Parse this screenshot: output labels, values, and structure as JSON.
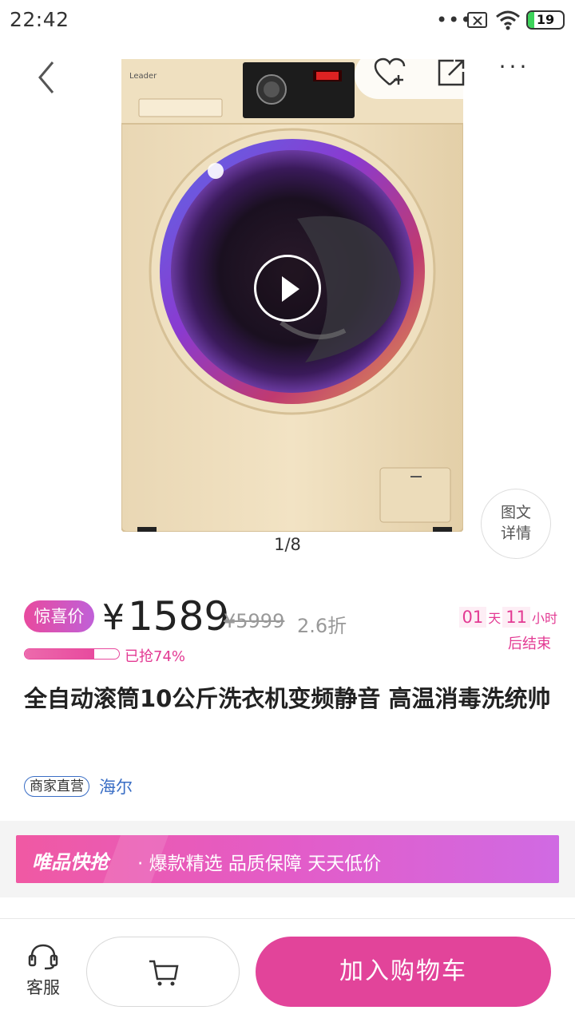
{
  "status_bar": {
    "time": "22:42",
    "battery": "19",
    "battery_level": 0.19
  },
  "hero": {
    "image_index": "1/8",
    "detail_button": [
      "图文",
      "详情"
    ]
  },
  "price": {
    "tag": "惊喜价",
    "currency": "¥",
    "current": "1589",
    "original": "¥5999",
    "discount": "2.6折",
    "sold_progress": 0.74,
    "sold_label": "已抢74%",
    "countdown": {
      "days": "01",
      "day_unit": "天",
      "hours": "11",
      "hour_unit": "小时",
      "end_label": "后结束"
    }
  },
  "product": {
    "title": "全自动滚筒10公斤洗衣机变频静音 高温消毒洗统帅",
    "merchant_tag": "商家直营",
    "brand": "海尔"
  },
  "promo_banner": {
    "brand": "唯品快抢",
    "text": "· 爆款精选  品质保障  天天低价"
  },
  "bottom_bar": {
    "service_label": "客服",
    "add_to_cart": "加入购物车"
  },
  "colors": {
    "accent": "#e2449a",
    "promo_gradient_start": "#f059a3",
    "promo_gradient_end": "#d06ae3",
    "link_blue": "#3a6ec5"
  },
  "icons": [
    "back-arrow-icon",
    "heart-plus-icon",
    "share-icon",
    "more-dots-icon",
    "play-icon",
    "headset-icon",
    "cart-icon"
  ]
}
